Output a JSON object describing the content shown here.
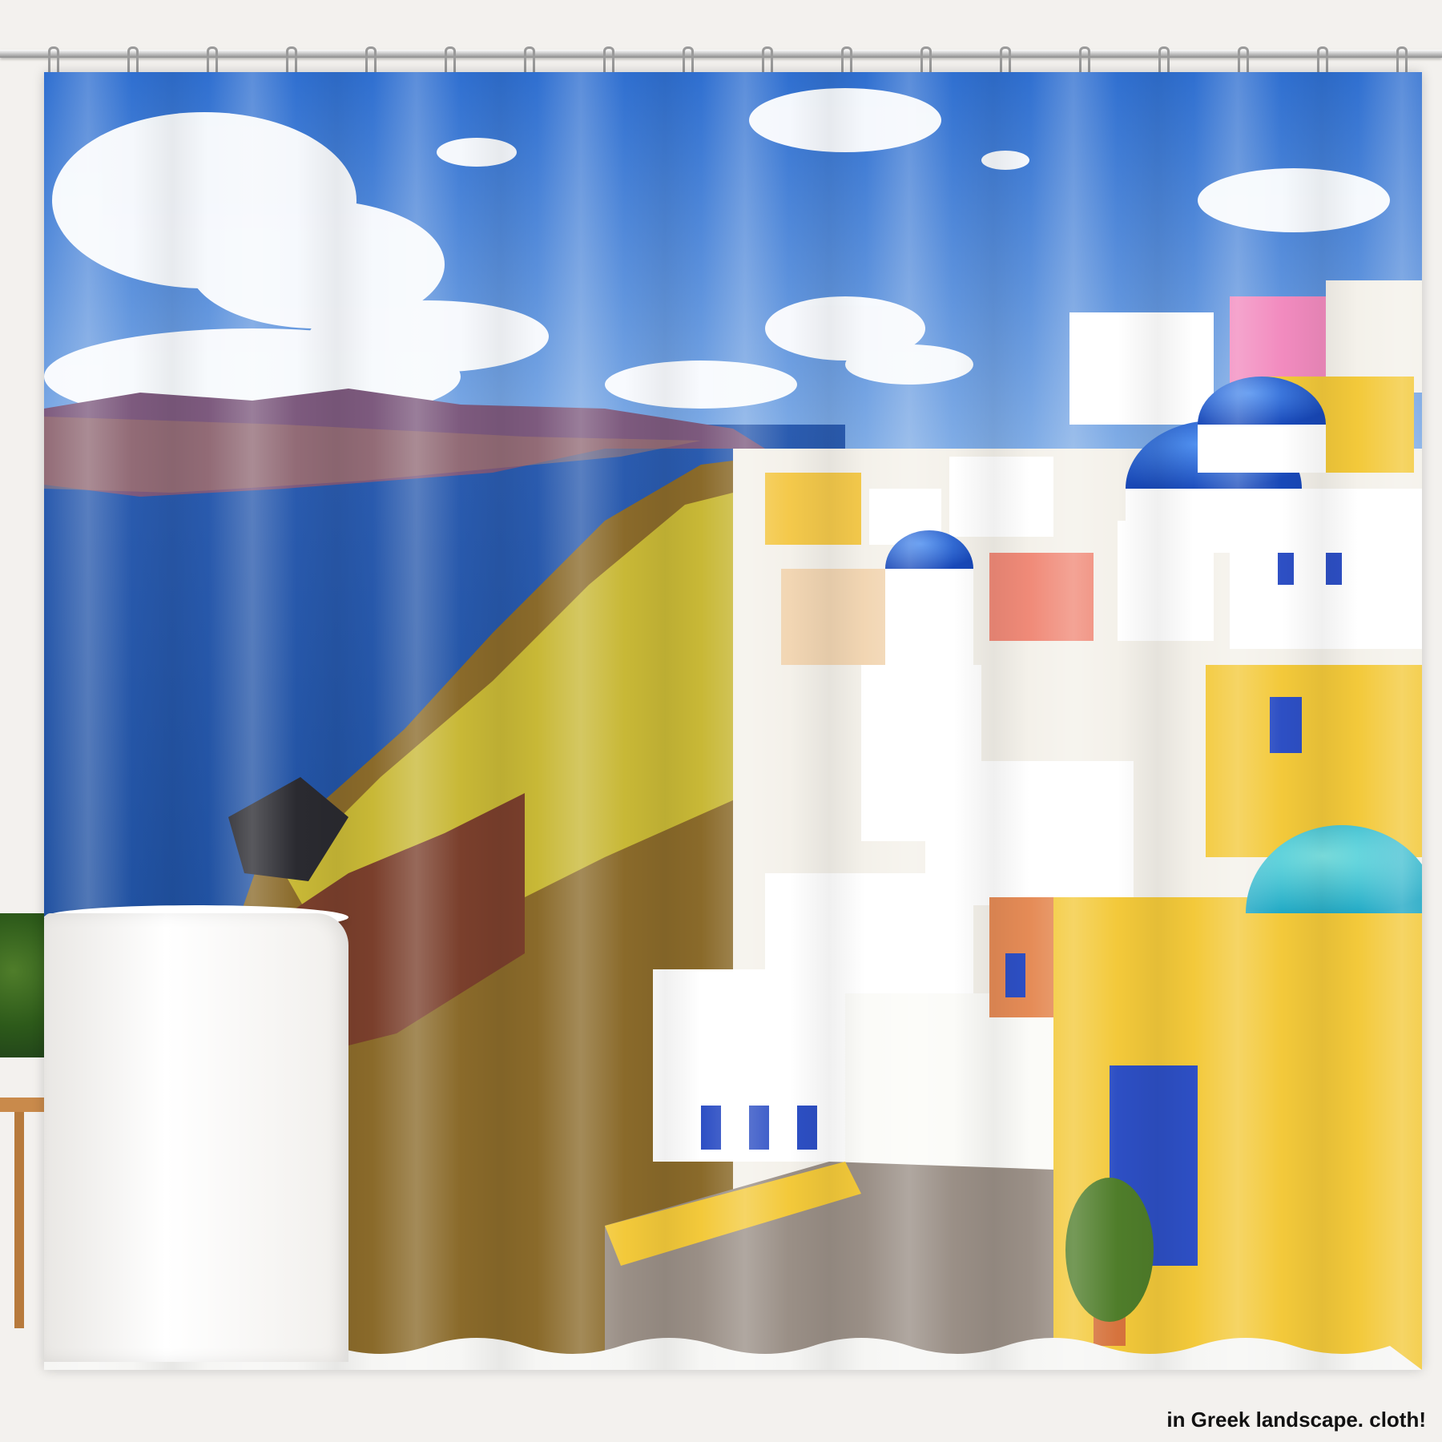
{
  "caption": "in Greek landscape. cloth!",
  "colors": {
    "sky": "#3f7fd6",
    "sea": "#2a5fb8",
    "dome": "#1f5fd0",
    "yellow": "#f3c93a",
    "white": "#ffffff"
  }
}
